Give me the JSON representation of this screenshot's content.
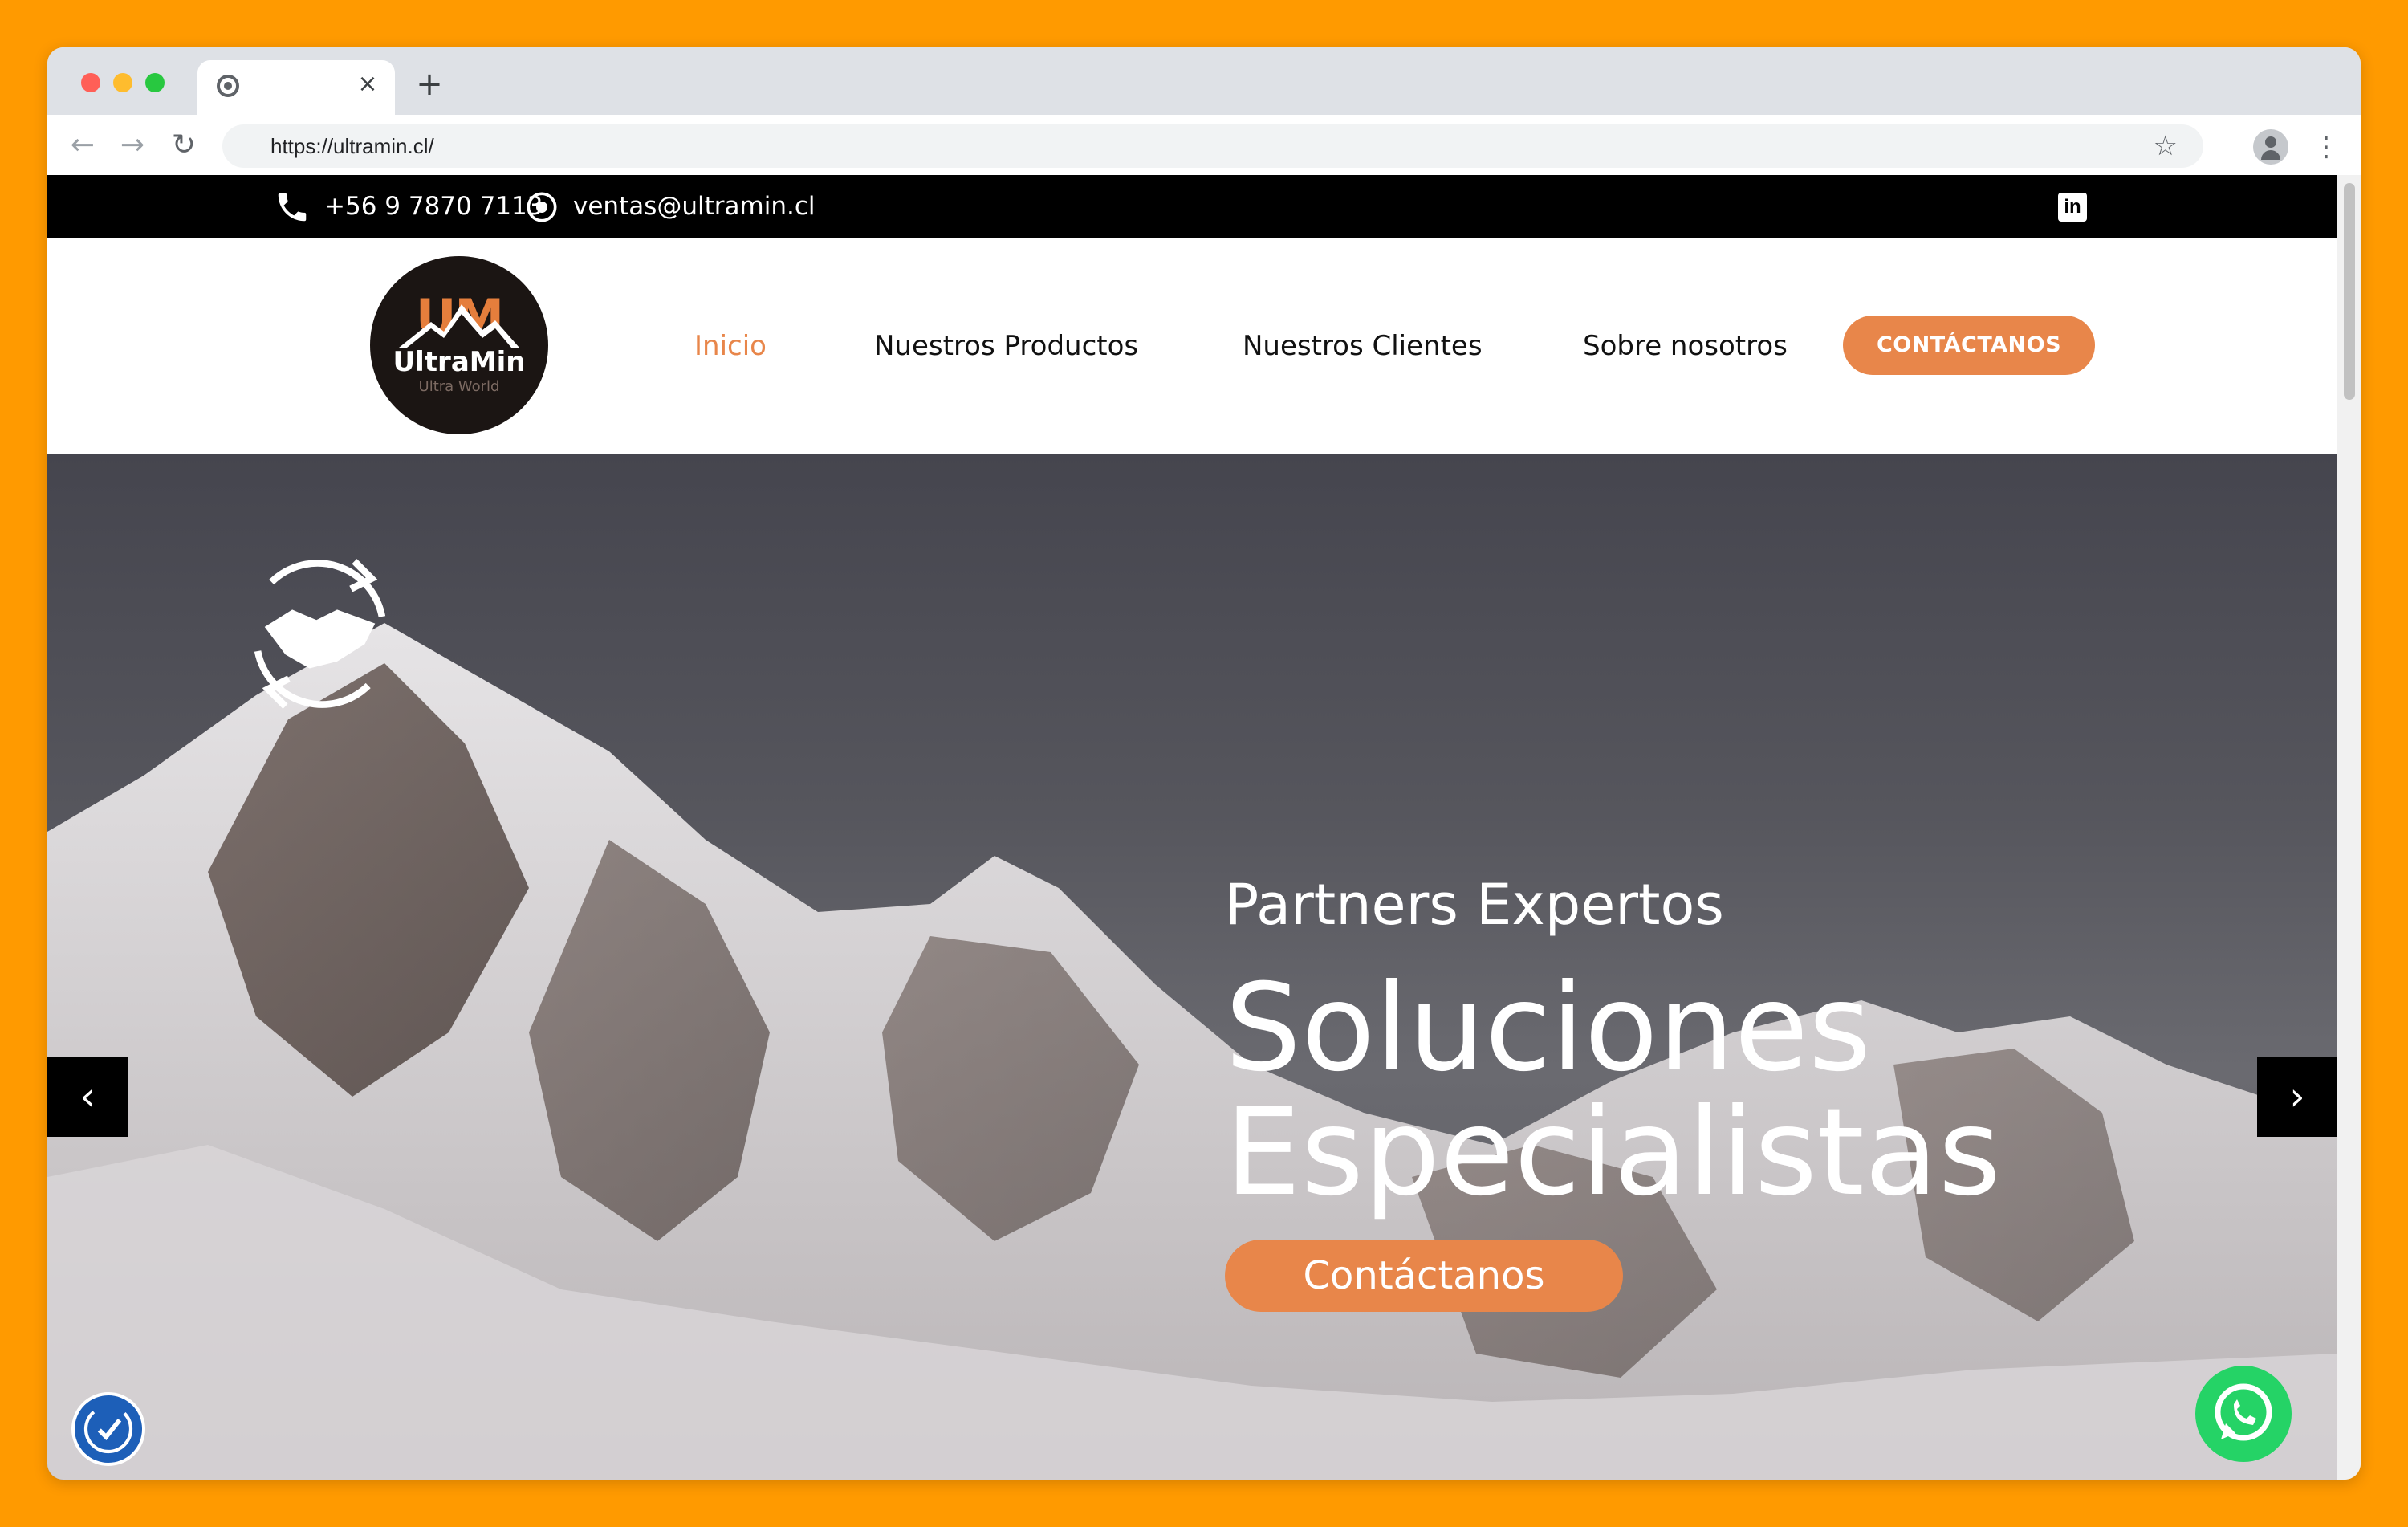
{
  "browser": {
    "tab_close": "×",
    "new_tab": "+",
    "url": "https://ultramin.cl/",
    "back": "←",
    "forward": "→",
    "reload": "↻",
    "star": "☆",
    "menu": "⋮"
  },
  "topbar": {
    "phone": "+56 9 7870 7113",
    "email": "ventas@ultramin.cl",
    "linkedin": "in"
  },
  "header": {
    "logo": {
      "monogram": "UM",
      "name": "UltraMin",
      "tagline": "Ultra World"
    },
    "menu": [
      {
        "label": "Inicio",
        "active": true
      },
      {
        "label": "Nuestros Productos",
        "active": false
      },
      {
        "label": "Nuestros Clientes",
        "active": false
      },
      {
        "label": "Sobre nosotros",
        "active": false
      }
    ],
    "cta": "CONTÁCTANOS"
  },
  "hero": {
    "subtitle": "Partners Expertos",
    "title_line1": "Soluciones",
    "title_line2": "Especialistas",
    "button": "Contáctanos",
    "prev": "‹",
    "next": "›"
  },
  "colors": {
    "accent": "#e8864a",
    "topbar_bg": "#000000",
    "page_frame": "#ff9a00",
    "whatsapp": "#25d366",
    "accessibility": "#1d5fb8"
  },
  "icons": [
    "phone-icon",
    "location-icon",
    "linkedin-icon",
    "handshake-icon",
    "chevron-left-icon",
    "chevron-right-icon",
    "accessibility-icon",
    "whatsapp-icon"
  ]
}
